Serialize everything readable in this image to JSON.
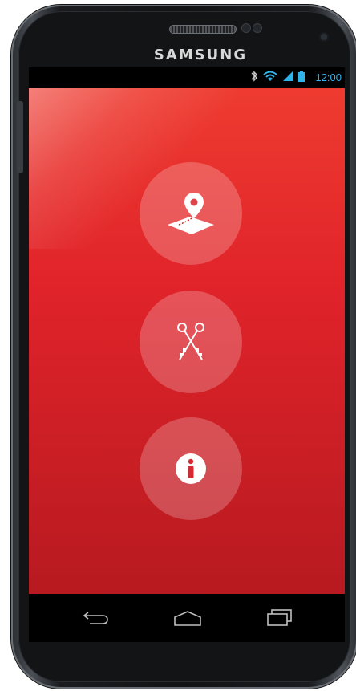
{
  "device": {
    "brand": "SAMSUNG"
  },
  "statusbar": {
    "time": "12:00",
    "icons": [
      "bluetooth-icon",
      "wifi-icon",
      "signal-icon",
      "battery-icon"
    ]
  },
  "colors": {
    "app_bg_top": "#ee3b30",
    "app_bg_bottom": "#b71a20",
    "status_accent": "#2fb3ea"
  },
  "main": {
    "buttons": [
      {
        "icon": "map-pin-icon"
      },
      {
        "icon": "keys-icon"
      },
      {
        "icon": "info-icon"
      }
    ]
  },
  "navbar": {
    "buttons": [
      {
        "icon": "back-icon"
      },
      {
        "icon": "home-icon"
      },
      {
        "icon": "recent-apps-icon"
      }
    ]
  }
}
